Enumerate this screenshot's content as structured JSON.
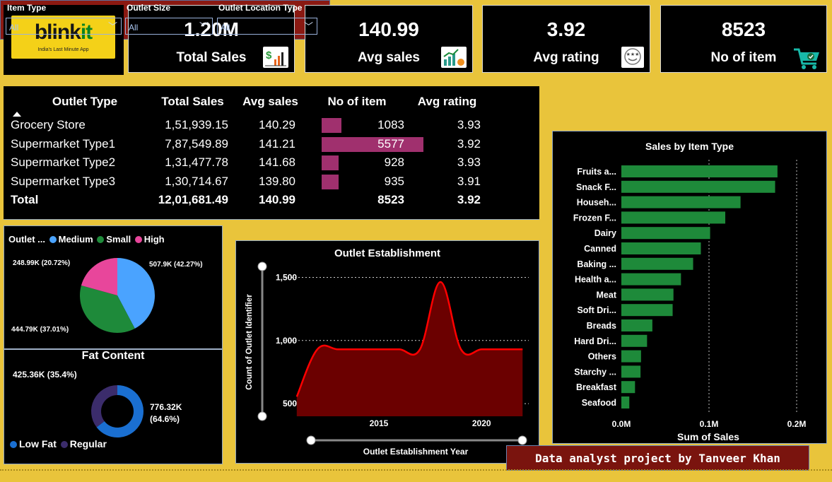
{
  "logo": {
    "word_a": "blink",
    "word_b": "it",
    "tagline": "India's Last Minute App"
  },
  "kpis": [
    {
      "value": "1.20M",
      "label": "Total Sales",
      "icon": "dollar-chart-icon"
    },
    {
      "value": "140.99",
      "label": "Avg sales",
      "icon": "growth-chart-icon"
    },
    {
      "value": "3.92",
      "label": "Avg rating",
      "icon": "rating-badge-icon"
    },
    {
      "value": "8523",
      "label": "No of item",
      "icon": "shopping-cart-icon"
    }
  ],
  "filters": [
    {
      "title": "Item Type",
      "value": "All"
    },
    {
      "title": "Outlet Size",
      "value": "All"
    },
    {
      "title": "Outlet Location Type",
      "value": "All"
    }
  ],
  "table": {
    "headers": [
      "Outlet Type",
      "Total Sales",
      "Avg sales",
      "No of item",
      "Avg rating"
    ],
    "rows": [
      {
        "type": "Grocery Store",
        "sales": "1,51,939.15",
        "avg": "140.29",
        "items": "1083",
        "items_value": 1083,
        "rating": "3.93"
      },
      {
        "type": "Supermarket Type1",
        "sales": "7,87,549.89",
        "avg": "141.21",
        "items": "5577",
        "items_value": 5577,
        "rating": "3.92"
      },
      {
        "type": "Supermarket Type2",
        "sales": "1,31,477.78",
        "avg": "141.68",
        "items": "928",
        "items_value": 928,
        "rating": "3.93"
      },
      {
        "type": "Supermarket Type3",
        "sales": "1,30,714.67",
        "avg": "139.80",
        "items": "935",
        "items_value": 935,
        "rating": "3.91"
      }
    ],
    "total": {
      "type": "Total",
      "sales": "12,01,681.49",
      "avg": "140.99",
      "items": "8523",
      "rating": "3.92"
    }
  },
  "chart_data": [
    {
      "type": "pie",
      "title": "Outlet ...",
      "legend_title": "Outlet ...",
      "legend_position": "top",
      "slices": [
        {
          "name": "Medium",
          "value": 507.9,
          "percent": 42.27,
          "label": "507.9K (42.27%)",
          "color": "#4aa3ff"
        },
        {
          "name": "Small",
          "value": 444.79,
          "percent": 37.01,
          "label": "444.79K (37.01%)",
          "color": "#1e8a3a"
        },
        {
          "name": "High",
          "value": 248.99,
          "percent": 20.72,
          "label": "248.99K (20.72%)",
          "color": "#e8469b"
        }
      ]
    },
    {
      "type": "pie",
      "subtype": "donut",
      "title": "Fat Content",
      "legend_position": "bottom",
      "slices": [
        {
          "name": "Low Fat",
          "value": 776.32,
          "percent": 64.6,
          "label": "776.32K (64.6%)",
          "color": "#1a6fd1"
        },
        {
          "name": "Regular",
          "value": 425.36,
          "percent": 35.4,
          "label": "425.36K (35.4%)",
          "color": "#3b2c6b"
        }
      ]
    },
    {
      "type": "area",
      "title": "Outlet Establishment",
      "xlabel": "Outlet Establishment Year",
      "ylabel": "Count of Outlet Identifier",
      "x_ticks": [
        2015,
        2020
      ],
      "y_ticks": [
        "500",
        "1,000",
        "1,500"
      ],
      "y_tick_values": [
        500,
        1000,
        1500
      ],
      "xlim": [
        2010.8,
        2022.3
      ],
      "ylim": [
        400,
        1620
      ],
      "grid": "horizontal-dotted",
      "color": "#ff0000",
      "fill": "#6b0000",
      "x": [
        2011,
        2012,
        2013,
        2014,
        2015,
        2016,
        2017,
        2018,
        2019,
        2020,
        2021,
        2022
      ],
      "y": [
        555,
        930,
        930,
        930,
        930,
        930,
        930,
        1463,
        930,
        930,
        930,
        930
      ]
    },
    {
      "type": "bar",
      "orientation": "horizontal",
      "title": "Sales by Item Type",
      "xlabel": "Sum of Sales",
      "ylabel": "",
      "x_ticks": [
        "0.0M",
        "0.1M",
        "0.2M"
      ],
      "x_tick_values": [
        0,
        100000,
        200000
      ],
      "xlim": [
        0,
        200000
      ],
      "grid": "vertical-dotted",
      "color": "#1e8a3a",
      "categories": [
        "Fruits a...",
        "Snack F...",
        "Househ...",
        "Frozen F...",
        "Dairy",
        "Canned",
        "Baking ...",
        "Health a...",
        "Meat",
        "Soft Dri...",
        "Breads",
        "Hard Dri...",
        "Others",
        "Starchy ...",
        "Breakfast",
        "Seafood"
      ],
      "values": [
        178124,
        175434,
        135977,
        118559,
        101277,
        90706,
        81895,
        68025,
        59450,
        58515,
        35380,
        29334,
        22451,
        21880,
        15597,
        9078
      ]
    }
  ],
  "credit": "Data analyst project by Tanveer Khan"
}
